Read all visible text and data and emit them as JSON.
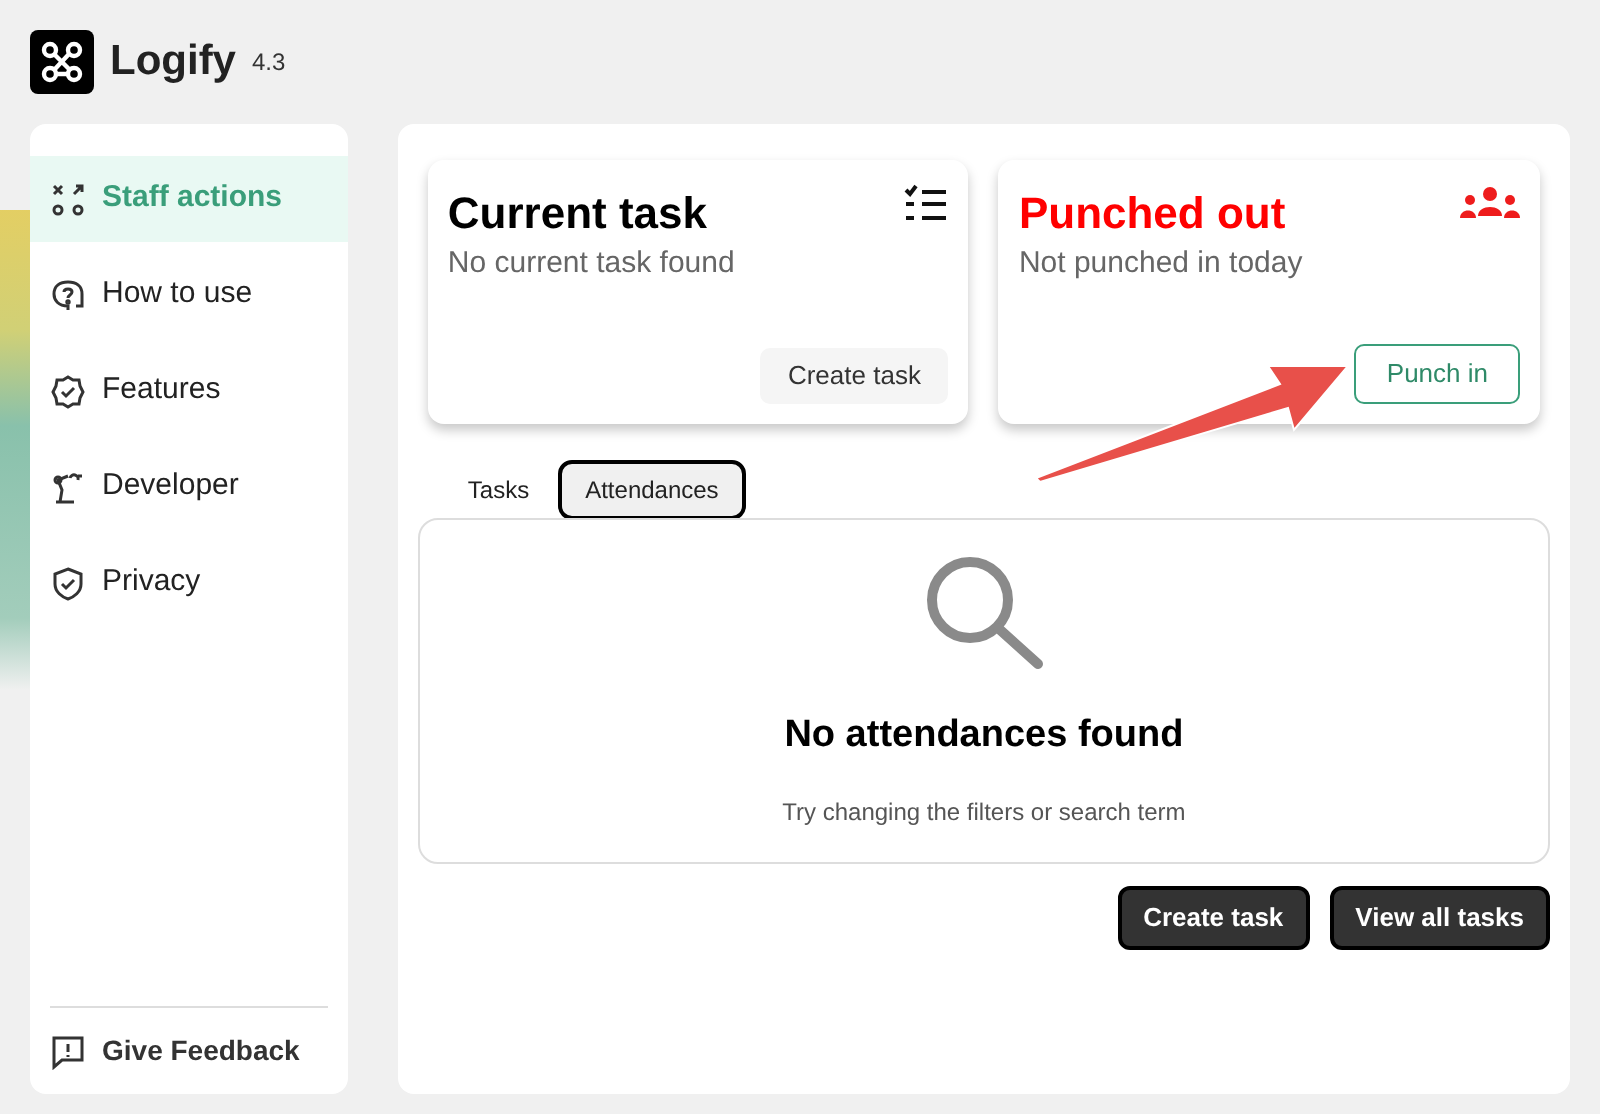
{
  "app": {
    "name": "Logify",
    "version": "4.3"
  },
  "sidebar": {
    "items": [
      {
        "label": "Staff actions",
        "kind": "actions",
        "selected": true
      },
      {
        "label": "How to use",
        "kind": "help",
        "selected": false
      },
      {
        "label": "Features",
        "kind": "badge",
        "selected": false
      },
      {
        "label": "Developer",
        "kind": "robot",
        "selected": false
      },
      {
        "label": "Privacy",
        "kind": "shield",
        "selected": false
      }
    ],
    "feedback": "Give Feedback"
  },
  "cards": [
    {
      "kind": "task",
      "title": "Current task",
      "subtitle": "No current task found",
      "button": "Create task"
    },
    {
      "kind": "attendance",
      "title": "Punched out",
      "subtitle": "Not punched in today",
      "button": "Punch in"
    }
  ],
  "tabs": [
    {
      "label": "Tasks",
      "selected": false
    },
    {
      "label": "Attendances",
      "selected": true
    }
  ],
  "empty_state": {
    "title": "No attendances found",
    "message": "Try changing the filters or search term"
  },
  "actions": [
    "Create task",
    "View all tasks"
  ]
}
